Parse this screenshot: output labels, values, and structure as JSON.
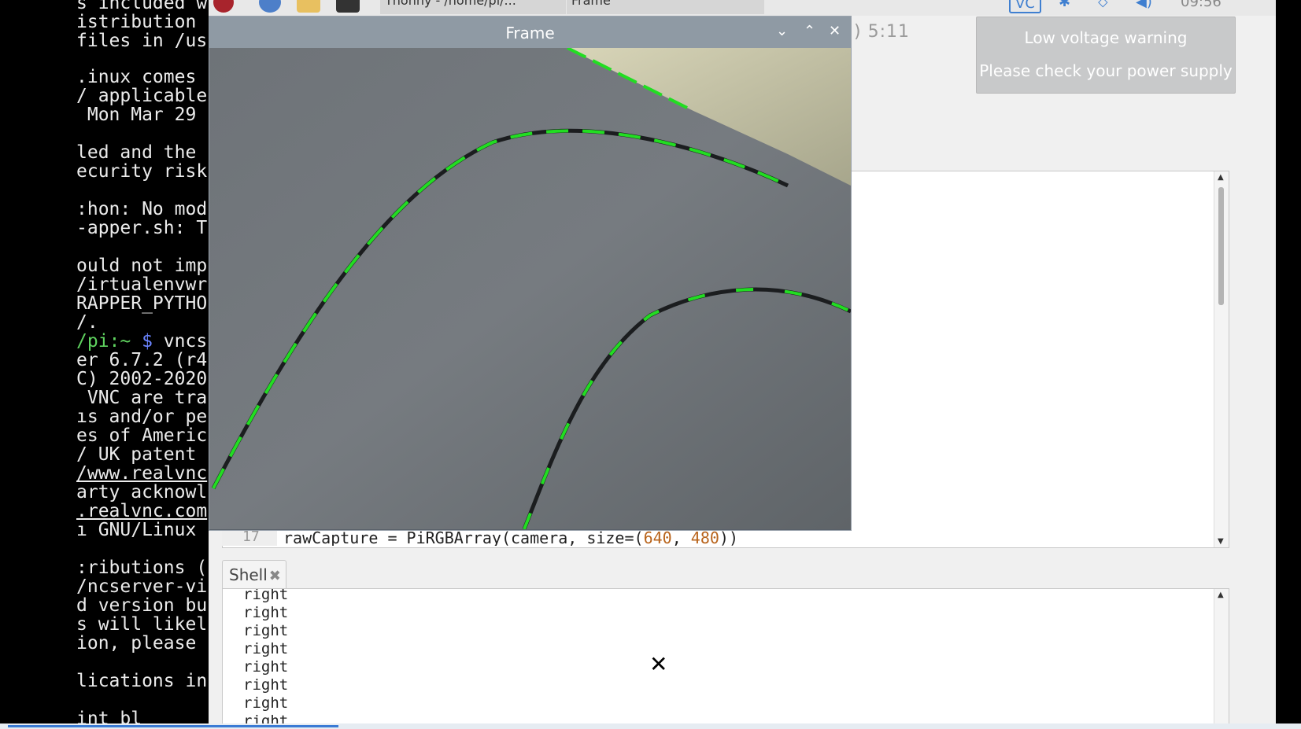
{
  "terminal": {
    "lines": [
      "s included w",
      "istribution",
      "files in /us",
      "",
      ".inux comes",
      "/ applicable",
      " Mon Mar 29",
      "",
      "led and the",
      "ecurity risk",
      "",
      ":hon: No mod",
      "-apper.sh: T",
      "",
      "ould not imp",
      "/irtualenvwr",
      "RAPPER_PYTHO",
      "/.",
      "/pi:~ $ vncs",
      "er 6.7.2 (r4",
      "C) 2002-2020",
      " VNC are tra",
      "ıs and/or pe",
      "es of Americ",
      "/ UK patent",
      "/www.realvnc",
      "arty acknowl",
      ".realvnc.com",
      "ı GNU/Linux",
      "",
      ":ributions (",
      "/ncserver-vi",
      "d version bu",
      "s will likel",
      "ion, please",
      "",
      "lications in",
      "",
      "int bl"
    ],
    "prompt_parts": [
      "/pi:~",
      " $ ",
      "vncs"
    ]
  },
  "taskbar": {
    "task1": "Thonny - /home/pi/...",
    "task2": "Frame",
    "tray": "VC",
    "time": "09:56"
  },
  "frame_window": {
    "title": "Frame",
    "minimize": "⌄",
    "maximize": "⌃",
    "close": "✕"
  },
  "thonny": {
    "clock_fragment": ") 5:11",
    "code_line_number": "17",
    "code_line": "rawCapture = PiRGBArray(camera, size=(640, 480))",
    "code_prefix": "rawCapture = PiRGBArray(camera, size=(",
    "code_num1": "640",
    "code_sep": ", ",
    "code_num2": "480",
    "code_suffix": "))",
    "shell_tab": "Shell",
    "shell_tab_close": "✖",
    "shell_output": [
      "right",
      "right",
      "right",
      "right",
      "right",
      "right",
      "right",
      "right"
    ]
  },
  "notification": {
    "title": "Low voltage warning",
    "message": "Please check your power supply"
  },
  "cursor_glyph": "✕",
  "colors": {
    "detected_line": "#22dd22",
    "title_bar": "#8f9aa4",
    "terminal_green": "#5fd35f",
    "accent_blue": "#3a7bd5"
  }
}
